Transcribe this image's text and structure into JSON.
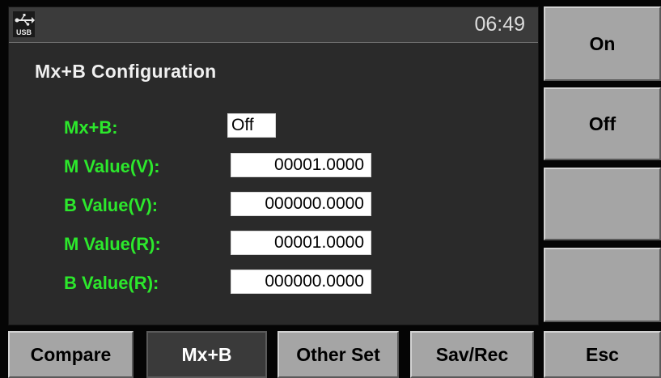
{
  "status_bar": {
    "usb_icon_label": "USB",
    "time": "06:49"
  },
  "config": {
    "title": "Mx+B Configuration",
    "fields": [
      {
        "label": "Mx+B:",
        "value": "Off"
      },
      {
        "label": "M Value(V):",
        "value": "00001.0000"
      },
      {
        "label": "B Value(V):",
        "value": "000000.0000"
      },
      {
        "label": "M Value(R):",
        "value": "00001.0000"
      },
      {
        "label": "B Value(R):",
        "value": "000000.0000"
      }
    ]
  },
  "side_keys": [
    {
      "label": "On"
    },
    {
      "label": "Off"
    },
    {
      "label": ""
    },
    {
      "label": ""
    }
  ],
  "bottom_keys": [
    {
      "label": "Compare"
    },
    {
      "label": "Mx+B",
      "selected": true
    },
    {
      "label": "Other Set"
    },
    {
      "label": "Sav/Rec"
    },
    {
      "label": "Esc"
    }
  ],
  "colors": {
    "label_green": "#2ce82c",
    "screen_bg": "#2a2a2a",
    "key_bg": "#a5a5a5"
  }
}
